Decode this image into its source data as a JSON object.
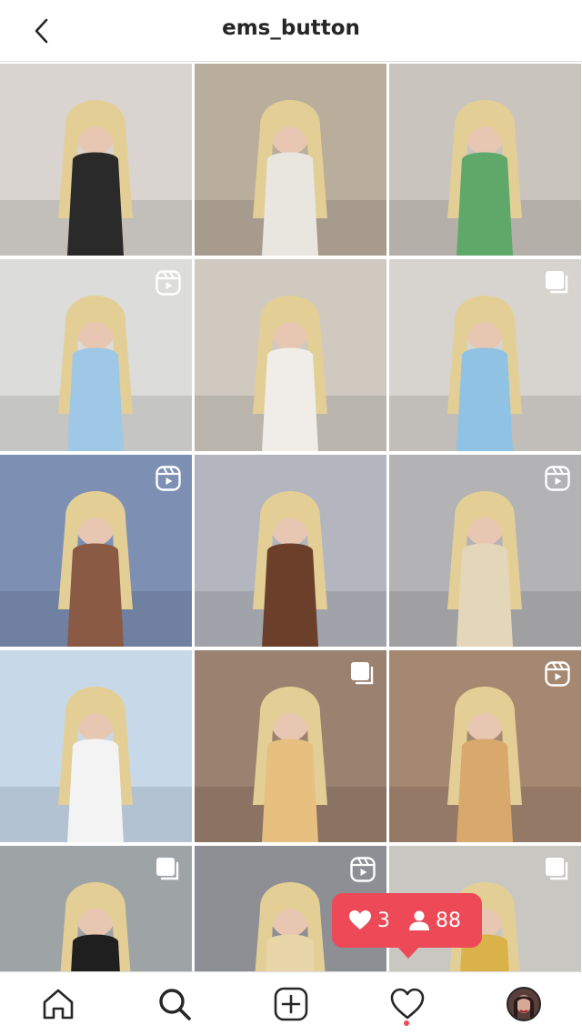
{
  "header": {
    "title": "ems_button",
    "back_icon": "chevron-left-icon"
  },
  "grid": {
    "posts": [
      {
        "badge": "none",
        "bg": "#d9d4cf",
        "accent": "#2a2a2a"
      },
      {
        "badge": "none",
        "bg": "#b9ad9c",
        "accent": "#e9e6e0"
      },
      {
        "badge": "none",
        "bg": "#c9c4bd",
        "accent": "#5fa86a"
      },
      {
        "badge": "reel",
        "bg": "#dcdcda",
        "accent": "#9fc7e6"
      },
      {
        "badge": "none",
        "bg": "#cfc9c0",
        "accent": "#f0ede8"
      },
      {
        "badge": "carousel",
        "bg": "#d7d4cf",
        "accent": "#8fc2e3"
      },
      {
        "badge": "reel",
        "bg": "#7d8fb3",
        "accent": "#8a5a44"
      },
      {
        "badge": "none",
        "bg": "#b4b6bf",
        "accent": "#6b3f2a"
      },
      {
        "badge": "reel",
        "bg": "#b3b3b6",
        "accent": "#e4d6b8"
      },
      {
        "badge": "none",
        "bg": "#c7d9e8",
        "accent": "#f3f3f3"
      },
      {
        "badge": "carousel",
        "bg": "#9b8170",
        "accent": "#e7c07f"
      },
      {
        "badge": "reel",
        "bg": "#a58872",
        "accent": "#d9a86c"
      },
      {
        "badge": "carousel",
        "bg": "#9ea3a6",
        "accent": "#1f1f1f"
      },
      {
        "badge": "reel",
        "bg": "#8d8f95",
        "accent": "#e9d6a8"
      },
      {
        "badge": "carousel",
        "bg": "#c9c7c2",
        "accent": "#d9b24a"
      }
    ]
  },
  "activity": {
    "likes_count": "3",
    "followers_count": "88",
    "like_icon": "heart-icon",
    "follower_icon": "person-icon"
  },
  "bottom_nav": [
    {
      "name": "home",
      "icon": "home-icon"
    },
    {
      "name": "search",
      "icon": "search-icon"
    },
    {
      "name": "create",
      "icon": "plus-square-icon"
    },
    {
      "name": "activity",
      "icon": "heart-icon"
    },
    {
      "name": "profile",
      "icon": "avatar"
    }
  ],
  "colors": {
    "notification": "#ed4956",
    "text": "#262626",
    "divider": "#dbdbdb"
  }
}
